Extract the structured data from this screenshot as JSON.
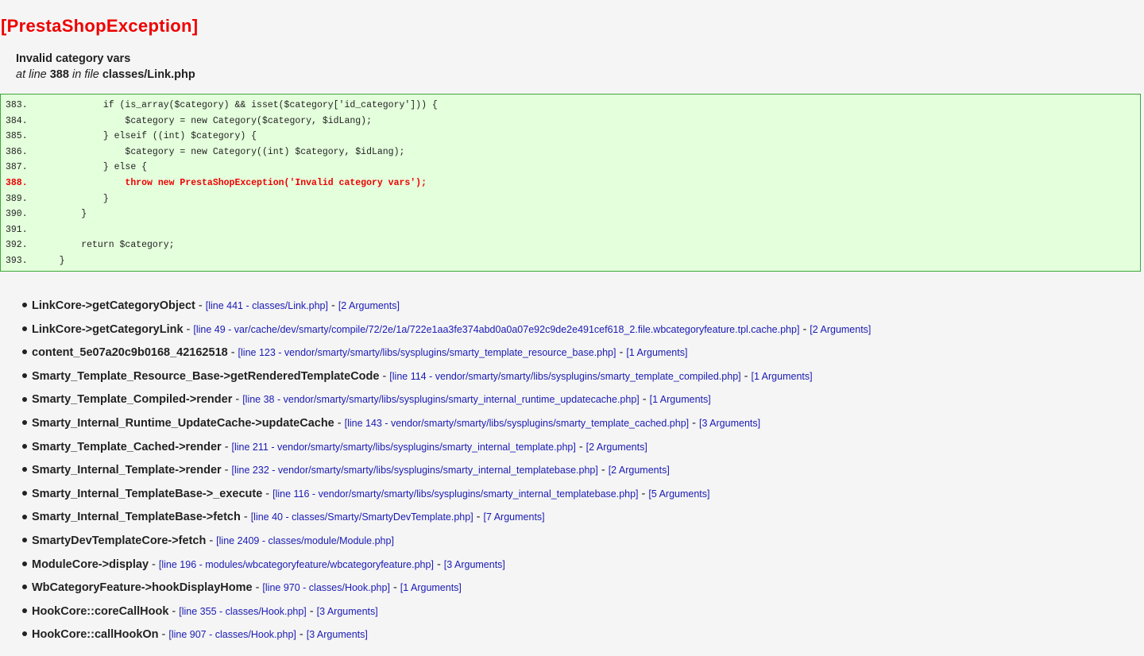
{
  "title": "[PrestaShopException]",
  "message": "Invalid category vars",
  "location": {
    "at_line_prefix": "at line",
    "line": "388",
    "in_file_prefix": "in file",
    "file": "classes/Link.php"
  },
  "code_lines": [
    {
      "num": "383.",
      "code": "            if (is_array($category) && isset($category['id_category'])) {",
      "error": false
    },
    {
      "num": "384.",
      "code": "                $category = new Category($category, $idLang);",
      "error": false
    },
    {
      "num": "385.",
      "code": "            } elseif ((int) $category) {",
      "error": false
    },
    {
      "num": "386.",
      "code": "                $category = new Category((int) $category, $idLang);",
      "error": false
    },
    {
      "num": "387.",
      "code": "            } else {",
      "error": false
    },
    {
      "num": "388.",
      "code": "                throw new PrestaShopException('Invalid category vars');",
      "error": true
    },
    {
      "num": "389.",
      "code": "            }",
      "error": false
    },
    {
      "num": "390.",
      "code": "        }",
      "error": false
    },
    {
      "num": "391.",
      "code": "",
      "error": false
    },
    {
      "num": "392.",
      "code": "        return $category;",
      "error": false
    },
    {
      "num": "393.",
      "code": "    }",
      "error": false
    }
  ],
  "separator": "-",
  "trace": [
    {
      "fn": "LinkCore->getCategoryObject",
      "location": "[line 441 - classes/Link.php]",
      "args": "[2 Arguments]"
    },
    {
      "fn": "LinkCore->getCategoryLink",
      "location": "[line 49 - var/cache/dev/smarty/compile/72/2e/1a/722e1aa3fe374abd0a0a07e92c9de2e491cef618_2.file.wbcategoryfeature.tpl.cache.php]",
      "args": "[2 Arguments]"
    },
    {
      "fn": "content_5e07a20c9b0168_42162518",
      "location": "[line 123 - vendor/smarty/smarty/libs/sysplugins/smarty_template_resource_base.php]",
      "args": "[1 Arguments]"
    },
    {
      "fn": "Smarty_Template_Resource_Base->getRenderedTemplateCode",
      "location": "[line 114 - vendor/smarty/smarty/libs/sysplugins/smarty_template_compiled.php]",
      "args": "[1 Arguments]"
    },
    {
      "fn": "Smarty_Template_Compiled->render",
      "location": "[line 38 - vendor/smarty/smarty/libs/sysplugins/smarty_internal_runtime_updatecache.php]",
      "args": "[1 Arguments]"
    },
    {
      "fn": "Smarty_Internal_Runtime_UpdateCache->updateCache",
      "location": "[line 143 - vendor/smarty/smarty/libs/sysplugins/smarty_template_cached.php]",
      "args": "[3 Arguments]"
    },
    {
      "fn": "Smarty_Template_Cached->render",
      "location": "[line 211 - vendor/smarty/smarty/libs/sysplugins/smarty_internal_template.php]",
      "args": "[2 Arguments]"
    },
    {
      "fn": "Smarty_Internal_Template->render",
      "location": "[line 232 - vendor/smarty/smarty/libs/sysplugins/smarty_internal_templatebase.php]",
      "args": "[2 Arguments]"
    },
    {
      "fn": "Smarty_Internal_TemplateBase->_execute",
      "location": "[line 116 - vendor/smarty/smarty/libs/sysplugins/smarty_internal_templatebase.php]",
      "args": "[5 Arguments]"
    },
    {
      "fn": "Smarty_Internal_TemplateBase->fetch",
      "location": "[line 40 - classes/Smarty/SmartyDevTemplate.php]",
      "args": "[7 Arguments]"
    },
    {
      "fn": "SmartyDevTemplateCore->fetch",
      "location": "[line 2409 - classes/module/Module.php]",
      "args": ""
    },
    {
      "fn": "ModuleCore->display",
      "location": "[line 196 - modules/wbcategoryfeature/wbcategoryfeature.php]",
      "args": "[3 Arguments]"
    },
    {
      "fn": "WbCategoryFeature->hookDisplayHome",
      "location": "[line 970 - classes/Hook.php]",
      "args": "[1 Arguments]"
    },
    {
      "fn": "HookCore::coreCallHook",
      "location": "[line 355 - classes/Hook.php]",
      "args": "[3 Arguments]"
    },
    {
      "fn": "HookCore::callHookOn",
      "location": "[line 907 - classes/Hook.php]",
      "args": "[3 Arguments]"
    }
  ]
}
